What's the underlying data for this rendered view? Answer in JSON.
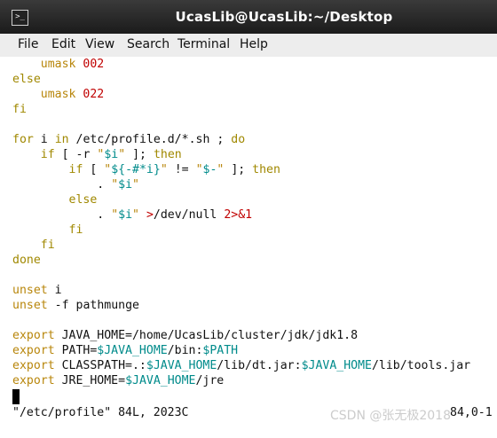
{
  "window": {
    "title": "UcasLib@UcasLib:~/Desktop",
    "icon": "terminal-icon"
  },
  "menu": [
    "File",
    "Edit",
    "View",
    "Search",
    "Terminal",
    "Help"
  ],
  "editor": {
    "lines": [
      "    umask 002",
      "else",
      "    umask 022",
      "fi",
      "",
      "for i in /etc/profile.d/*.sh ; do",
      "    if [ -r \"$i\" ]; then",
      "        if [ \"${-#*i}\" != \"$-\" ]; then",
      "            . \"$i\"",
      "        else",
      "            . \"$i\" >/dev/null 2>&1",
      "        fi",
      "    fi",
      "done",
      "",
      "unset i",
      "unset -f pathmunge",
      "",
      "export JAVA_HOME=/home/UcasLib/cluster/jdk/jdk1.8",
      "export PATH=$JAVA_HOME/bin:$PATH",
      "export CLASSPATH=.:$JAVA_HOME/lib/dt.jar:$JAVA_HOME/lib/tools.jar",
      "export JRE_HOME=$JAVA_HOME/jre"
    ],
    "status_file": "\"/etc/profile\" 84L, 2023C",
    "status_pos": "84,0-1"
  },
  "watermark": "CSDN @张无极2018"
}
